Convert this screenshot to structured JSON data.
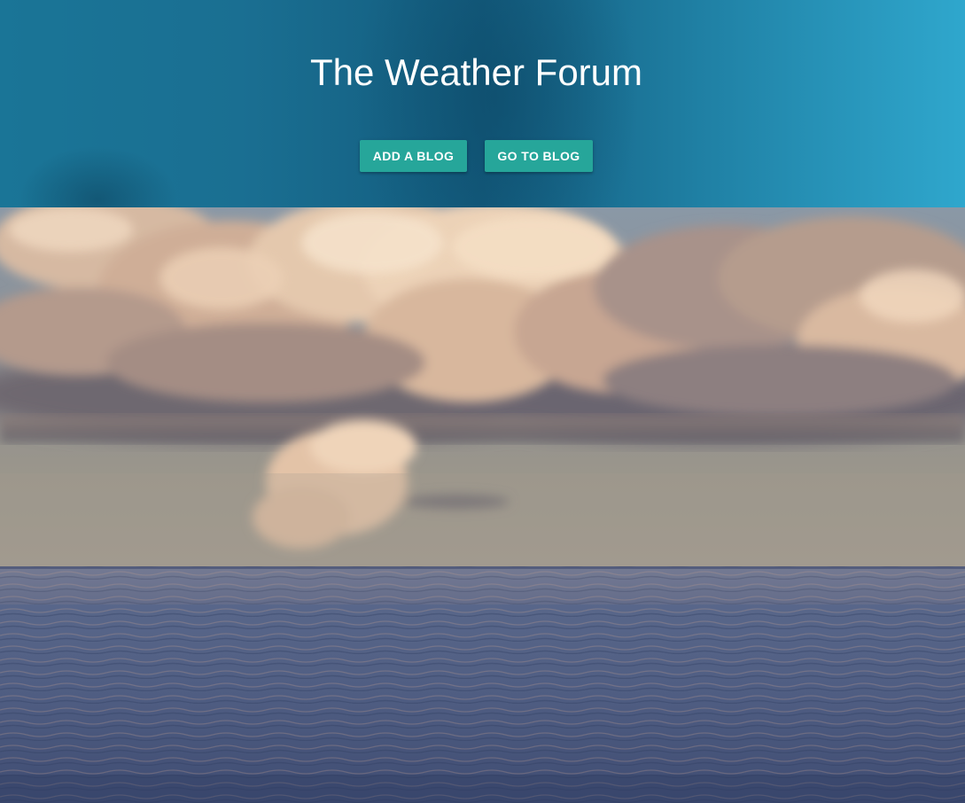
{
  "header": {
    "title": "The Weather Forum",
    "buttons": {
      "add_blog": "ADD A BLOG",
      "go_to_blog": "GO TO BLOG"
    }
  },
  "colors": {
    "header_left": "#1a7597",
    "header_center": "#135c7e",
    "header_right": "#2fa7cd",
    "button": "#26a69a",
    "text": "#ffffff"
  },
  "hero": {
    "subject": "stormy-clouds-over-ocean"
  }
}
